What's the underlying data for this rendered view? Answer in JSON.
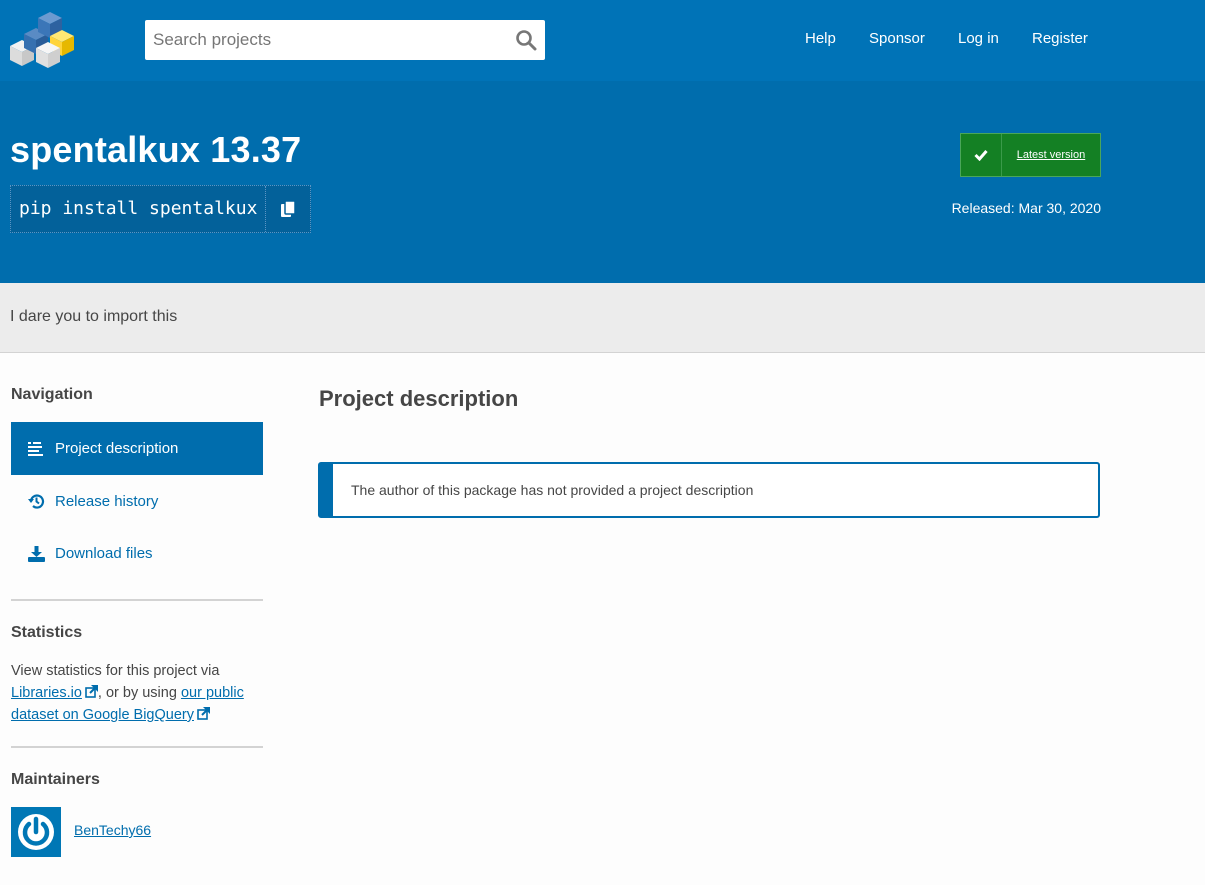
{
  "header": {
    "search_placeholder": "Search projects",
    "nav": [
      "Help",
      "Sponsor",
      "Log in",
      "Register"
    ],
    "logo_icon": "pypi-cubes-logo",
    "search_icon": "magnifier-icon"
  },
  "package": {
    "title": "spentalkux 13.37",
    "pip_command": "pip install spentalkux",
    "copy_icon": "copy-icon",
    "latest_label": "Latest version",
    "released": "Released: Mar 30, 2020",
    "summary": "I dare you to import this"
  },
  "sidebar": {
    "nav_heading": "Navigation",
    "items": [
      {
        "label": "Project description",
        "icon": "align-left-icon",
        "active": true
      },
      {
        "label": "Release history",
        "icon": "history-icon",
        "active": false
      },
      {
        "label": "Download files",
        "icon": "download-icon",
        "active": false
      }
    ],
    "stats_heading": "Statistics",
    "stats_text_1": "View statistics for this project via",
    "stats_link_1": "Libraries.io",
    "stats_text_2": ", or by using",
    "stats_link_2": "our public dataset on Google BigQuery",
    "maintainers_heading": "Maintainers",
    "maintainer": "BenTechy66"
  },
  "main": {
    "heading": "Project description",
    "callout": "The author of this package has not provided a project description"
  },
  "colors": {
    "header_blue": "#0073b7",
    "banner_blue": "#006dad",
    "latest_green": "#148024",
    "summary_gray": "#ececec"
  }
}
